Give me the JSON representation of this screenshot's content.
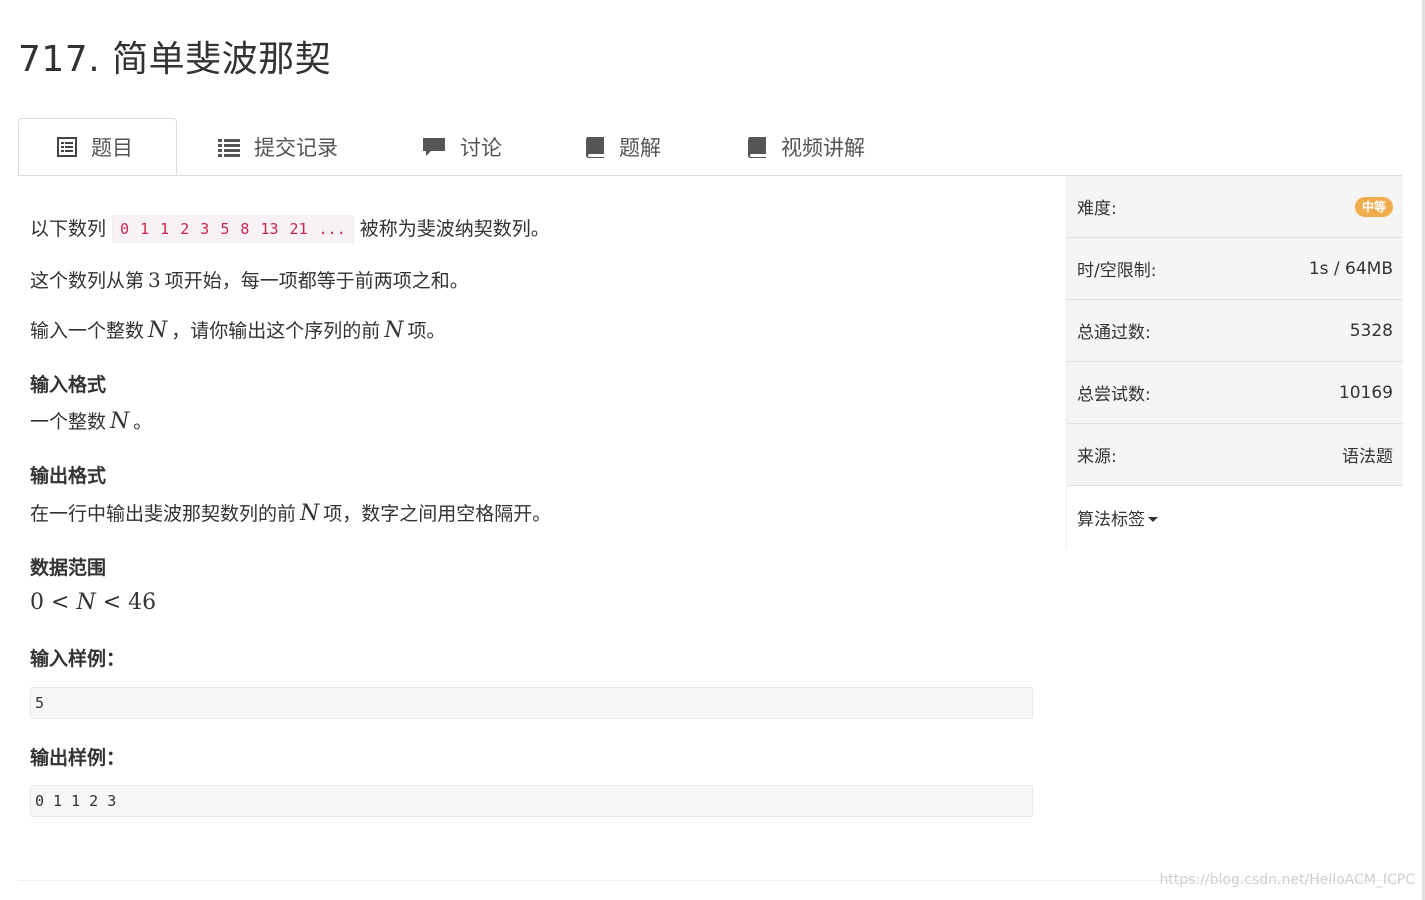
{
  "problem": {
    "title": "717. 简单斐波那契"
  },
  "tabs": [
    {
      "label": "题目",
      "icon": "document-list-icon",
      "active": true
    },
    {
      "label": "提交记录",
      "icon": "list-icon",
      "active": false
    },
    {
      "label": "讨论",
      "icon": "comment-icon",
      "active": false
    },
    {
      "label": "题解",
      "icon": "book-icon",
      "active": false
    },
    {
      "label": "视频讲解",
      "icon": "book-icon",
      "active": false
    }
  ],
  "description": {
    "p1_prefix": "以下数列",
    "p1_code": "0 1 1 2 3 5 8 13 21 ...",
    "p1_suffix": "被称为斐波纳契数列。",
    "p2_prefix": "这个数列从第",
    "p2_num": "3",
    "p2_suffix": "项开始，每一项都等于前两项之和。",
    "p3_prefix": "输入一个整数",
    "p3_var": "N",
    "p3_mid": "，请你输出这个序列的前",
    "p3_var2": "N",
    "p3_suffix": "项。",
    "input_format_heading": "输入格式",
    "input_format_prefix": "一个整数",
    "input_format_var": "N",
    "input_format_suffix": "。",
    "output_format_heading": "输出格式",
    "output_format_prefix": "在一行中输出斐波那契数列的前",
    "output_format_var": "N",
    "output_format_suffix": "项，数字之间用空格隔开。",
    "range_heading": "数据范围",
    "range_low": "0",
    "range_lt1": "<",
    "range_var": "N",
    "range_lt2": "<",
    "range_high": "46",
    "sample_input_heading": "输入样例：",
    "sample_input": "5",
    "sample_output_heading": "输出样例：",
    "sample_output": "0 1 1 2 3"
  },
  "info": {
    "difficulty_label": "难度:",
    "difficulty_value": "中等",
    "difficulty_color": "#f0ad4e",
    "limit_label": "时/空限制:",
    "limit_value": "1s / 64MB",
    "passed_label": "总通过数:",
    "passed_value": "5328",
    "tries_label": "总尝试数:",
    "tries_value": "10169",
    "source_label": "来源:",
    "source_value": "语法题",
    "tags_label": "算法标签"
  },
  "watermark": "https://blog.csdn.net/HelloACM_ICPC"
}
